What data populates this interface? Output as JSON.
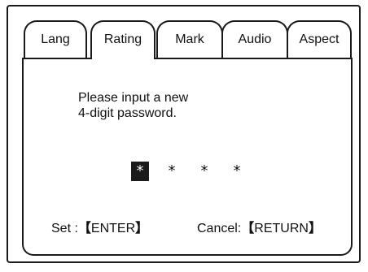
{
  "tabs": [
    {
      "label": "Lang"
    },
    {
      "label": "Rating"
    },
    {
      "label": "Mark"
    },
    {
      "label": "Audio"
    },
    {
      "label": "Aspect"
    }
  ],
  "active_tab": "Rating",
  "message": {
    "line1": "Please input a new",
    "line2": "4-digit password."
  },
  "password": {
    "digits": [
      "*",
      "*",
      "*",
      "*"
    ],
    "selected_index": 0
  },
  "hints": {
    "set_label": "Set :",
    "set_key": "ENTER",
    "cancel_label": "Cancel:",
    "cancel_key": "RETURN",
    "bracket_open": "【",
    "bracket_close": "】"
  }
}
